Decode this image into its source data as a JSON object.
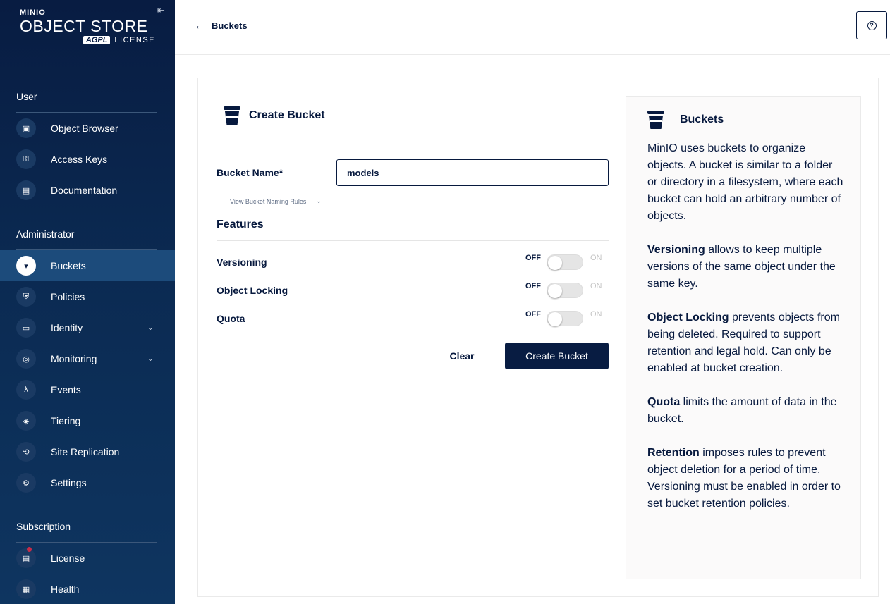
{
  "logo": {
    "brand_prefix": "MIN",
    "brand_suffix": "IO",
    "product": "OBJECT STORE",
    "agpl": "AGPL",
    "license": "LICENSE"
  },
  "sections": {
    "user": "User",
    "administrator": "Administrator",
    "subscription": "Subscription"
  },
  "nav": {
    "object_browser": "Object Browser",
    "access_keys": "Access Keys",
    "documentation": "Documentation",
    "buckets": "Buckets",
    "policies": "Policies",
    "identity": "Identity",
    "monitoring": "Monitoring",
    "events": "Events",
    "tiering": "Tiering",
    "site_replication": "Site Replication",
    "settings": "Settings",
    "license": "License",
    "health": "Health"
  },
  "header": {
    "back_label": "Buckets",
    "help_symbol": "?"
  },
  "form": {
    "title": "Create Bucket",
    "bucket_name_label": "Bucket Name*",
    "bucket_name_value": "models",
    "naming_rules": "View Bucket Naming Rules",
    "features_title": "Features",
    "features": [
      {
        "label": "Versioning",
        "off": "OFF",
        "on": "ON",
        "enabled": false
      },
      {
        "label": "Object Locking",
        "off": "OFF",
        "on": "ON",
        "enabled": false
      },
      {
        "label": "Quota",
        "off": "OFF",
        "on": "ON",
        "enabled": false
      }
    ],
    "clear_label": "Clear",
    "create_label": "Create Bucket"
  },
  "help": {
    "title": "Buckets",
    "intro": "MinIO uses buckets to organize objects. A bucket is similar to a folder or directory in a filesystem, where each bucket can hold an arbitrary number of objects.",
    "versioning_term": "Versioning",
    "versioning_text": " allows to keep multiple versions of the same object under the same key.",
    "locking_term": "Object Locking",
    "locking_text": " prevents objects from being deleted. Required to support retention and legal hold. Can only be enabled at bucket creation.",
    "quota_term": "Quota",
    "quota_text": " limits the amount of data in the bucket.",
    "retention_term": "Retention",
    "retention_text": " imposes rules to prevent object deletion for a period of time. Versioning must be enabled in order to set bucket retention policies."
  }
}
